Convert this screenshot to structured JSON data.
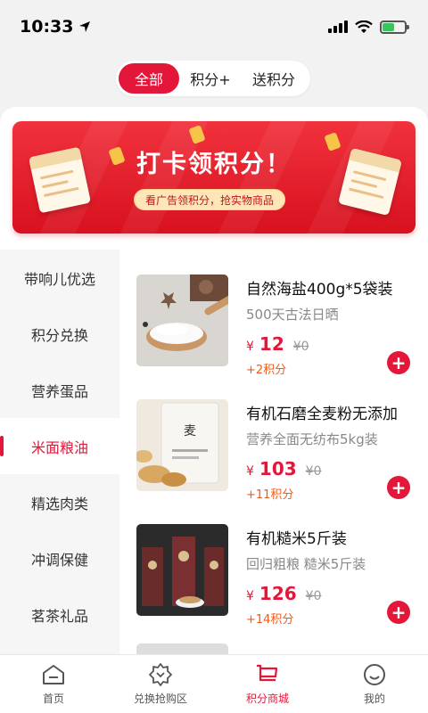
{
  "status_bar": {
    "time": "10:33"
  },
  "segment_tabs": [
    {
      "label": "全部",
      "active": true
    },
    {
      "label": "积分+",
      "active": false
    },
    {
      "label": "送积分",
      "active": false
    }
  ],
  "banner": {
    "title": "打卡领积分！",
    "subtitle": "看广告领积分，抢实物商品"
  },
  "categories": [
    {
      "label": "带响儿优选",
      "active": false
    },
    {
      "label": "积分兑换",
      "active": false
    },
    {
      "label": "营养蛋品",
      "active": false
    },
    {
      "label": "米面粮油",
      "active": true
    },
    {
      "label": "精选肉类",
      "active": false
    },
    {
      "label": "冲调保健",
      "active": false
    },
    {
      "label": "茗茶礼品",
      "active": false
    }
  ],
  "products": [
    {
      "name": "自然海盐400g*5袋装",
      "subtitle": "500天古法日晒",
      "currency": "¥",
      "price": "12",
      "old_price": "¥0",
      "points": "+2积分"
    },
    {
      "name": "有机石磨全麦粉无添加",
      "subtitle": "营养全面无纺布5kg装",
      "currency": "¥",
      "price": "103",
      "old_price": "¥0",
      "points": "+11积分"
    },
    {
      "name": "有机糙米5斤装",
      "subtitle": "回归粗粮 糙米5斤装",
      "currency": "¥",
      "price": "126",
      "old_price": "¥0",
      "points": "+14积分"
    }
  ],
  "bottom_nav": [
    {
      "label": "首页",
      "icon": "home-icon",
      "active": false
    },
    {
      "label": "兑换抢购区",
      "icon": "badge-icon",
      "active": false
    },
    {
      "label": "积分商城",
      "icon": "cart-icon",
      "active": true
    },
    {
      "label": "我的",
      "icon": "smile-icon",
      "active": false
    }
  ],
  "colors": {
    "accent": "#e3173a",
    "points": "#f05a1a"
  }
}
